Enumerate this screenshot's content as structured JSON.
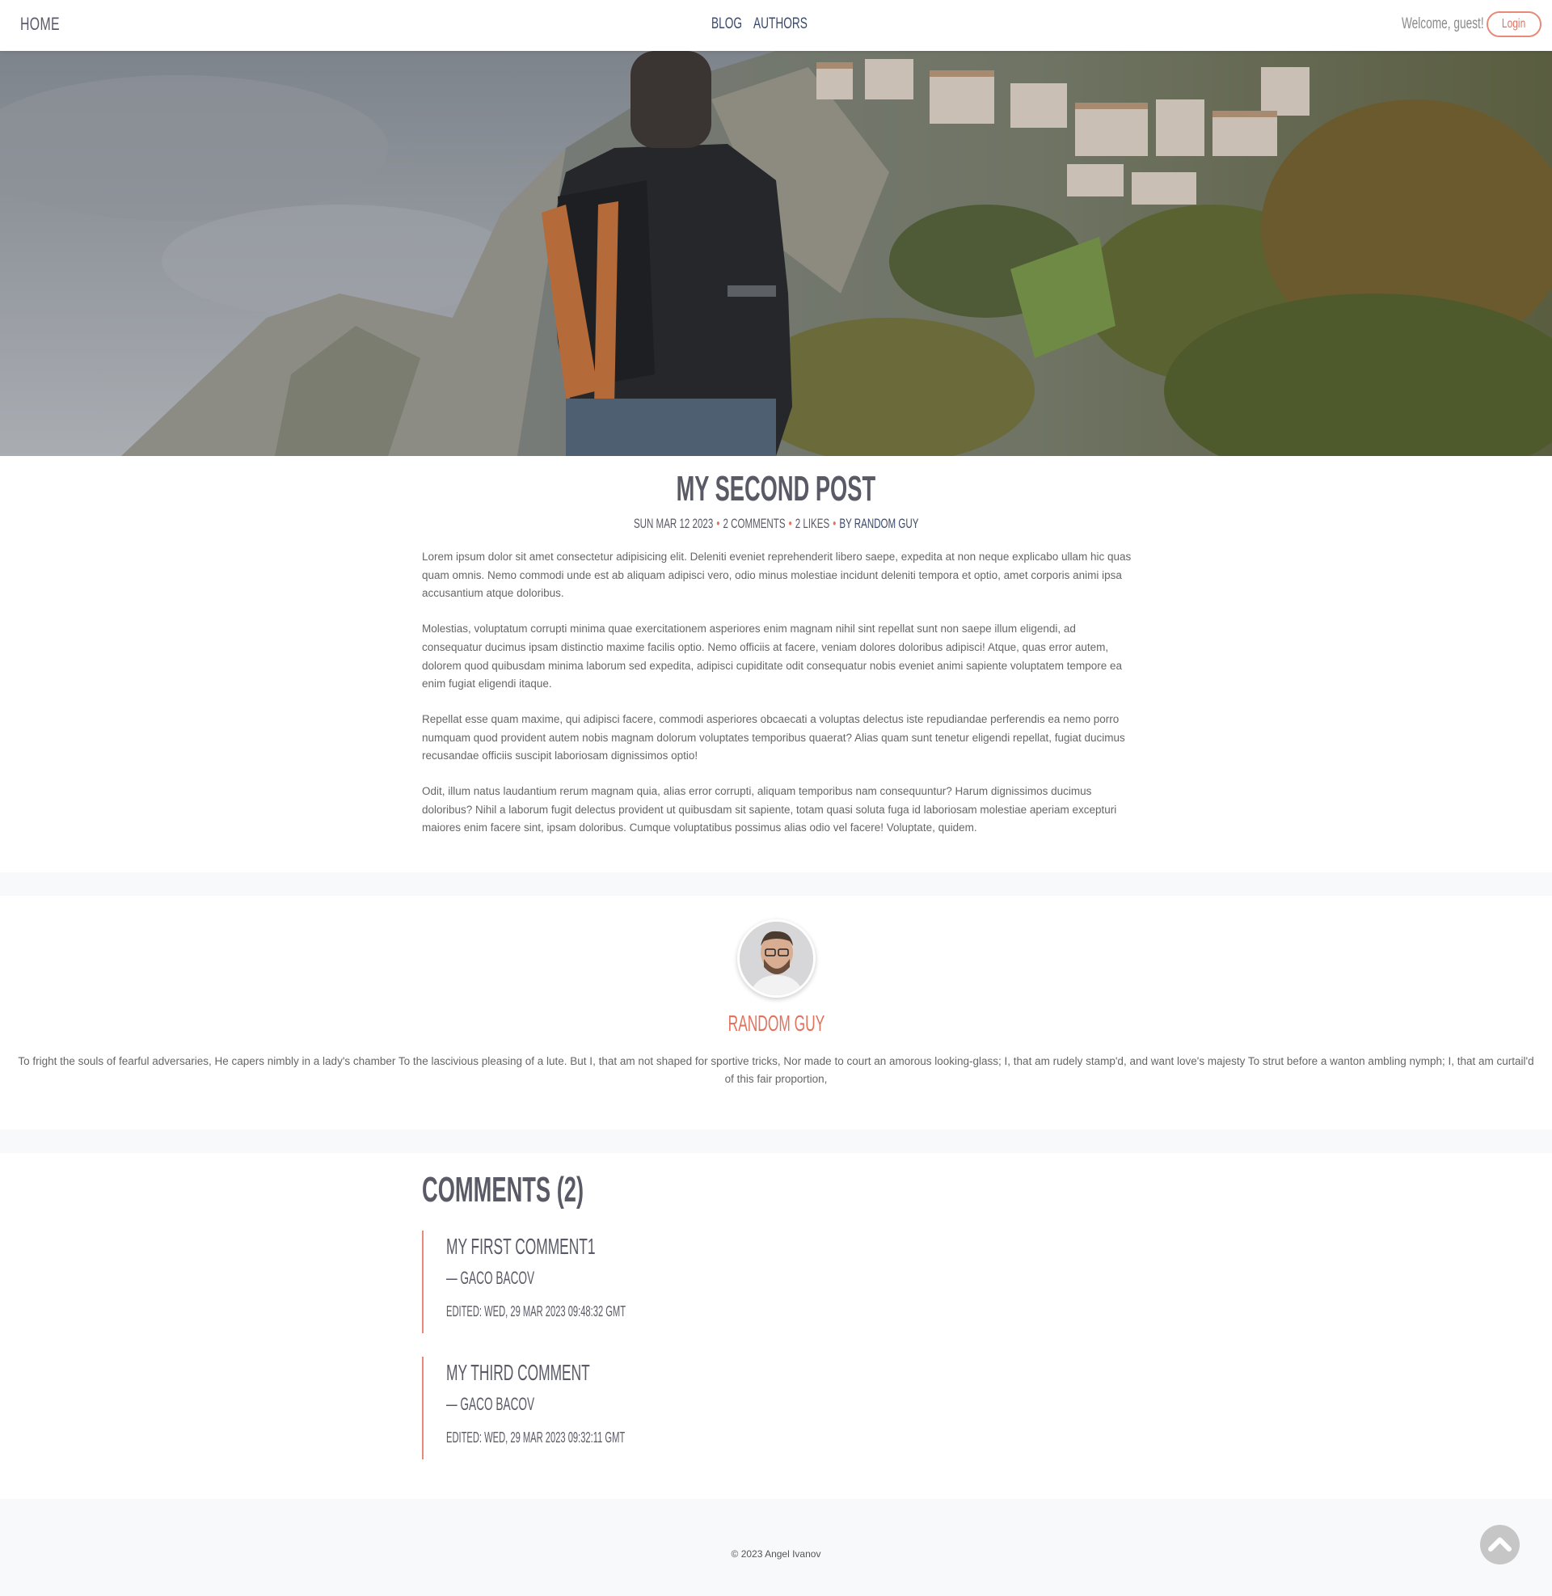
{
  "header": {
    "home_label": "HOME",
    "nav": [
      "BLOG",
      "AUTHORS"
    ],
    "welcome": "Welcome, guest!",
    "login_label": "Login",
    "accent": "#e0735e"
  },
  "hero": {
    "image": "backpacker-overlooking-hill-village"
  },
  "post": {
    "title": "My second post",
    "date": "Sun Mar 12 2023",
    "comments": "2 Comments",
    "likes": "2 Likes",
    "author": "By Random Guy",
    "paragraphs": [
      "Lorem ipsum dolor sit amet consectetur adipisicing elit. Deleniti eveniet reprehenderit libero saepe, expedita at non neque explicabo ullam hic quas quam omnis. Nemo commodi unde est ab aliquam adipisci vero, odio minus molestiae incidunt deleniti tempora et optio, amet corporis animi ipsa accusantium atque doloribus.",
      "Molestias, voluptatum corrupti minima quae exercitationem asperiores enim magnam nihil sint repellat sunt non saepe illum eligendi, ad consequatur ducimus ipsam distinctio maxime facilis optio. Nemo officiis at facere, veniam dolores doloribus adipisci! Atque, quas error autem, dolorem quod quibusdam minima laborum sed expedita, adipisci cupiditate odit consequatur nobis eveniet animi sapiente voluptatem tempore ea enim fugiat eligendi itaque.",
      "Repellat esse quam maxime, qui adipisci facere, commodi asperiores obcaecati a voluptas delectus iste repudiandae perferendis ea nemo porro numquam quod provident autem nobis magnam dolorum voluptates temporibus quaerat? Alias quam sunt tenetur eligendi repellat, fugiat ducimus recusandae officiis suscipit laboriosam dignissimos optio!",
      "Odit, illum natus laudantium rerum magnam quia, alias error corrupti, aliquam temporibus nam consequuntur? Harum dignissimos ducimus doloribus? Nihil a laborum fugit delectus provident ut quibusdam sit sapiente, totam quasi soluta fuga id laboriosam molestiae aperiam excepturi maiores enim facere sint, ipsam doloribus. Cumque voluptatibus possimus alias odio vel facere! Voluptate, quidem."
    ]
  },
  "author": {
    "name": "Random Guy",
    "bio": "To fright the souls of fearful adversaries, He capers nimbly in a lady's chamber To the lascivious pleasing of a lute. But I, that am not shaped for sportive tricks, Nor made to court an amorous looking-glass; I, that am rudely stamp'd, and want love's majesty To strut before a wanton ambling nymph; I, that am curtail'd of this fair proportion,"
  },
  "comments": {
    "heading": "Comments (2)",
    "items": [
      {
        "text": "My first comment1",
        "author": "— Gaco Bacov",
        "edited": "Edited: Wed, 29 Mar 2023 09:48:32 GMT"
      },
      {
        "text": "My third comment",
        "author": "— Gaco Bacov",
        "edited": "Edited: Wed, 29 Mar 2023 09:32:11 GMT"
      }
    ]
  },
  "footer": {
    "copyright": "© 2023 Angel Ivanov"
  },
  "scroll_top": {
    "icon": "chevron-up-icon"
  }
}
